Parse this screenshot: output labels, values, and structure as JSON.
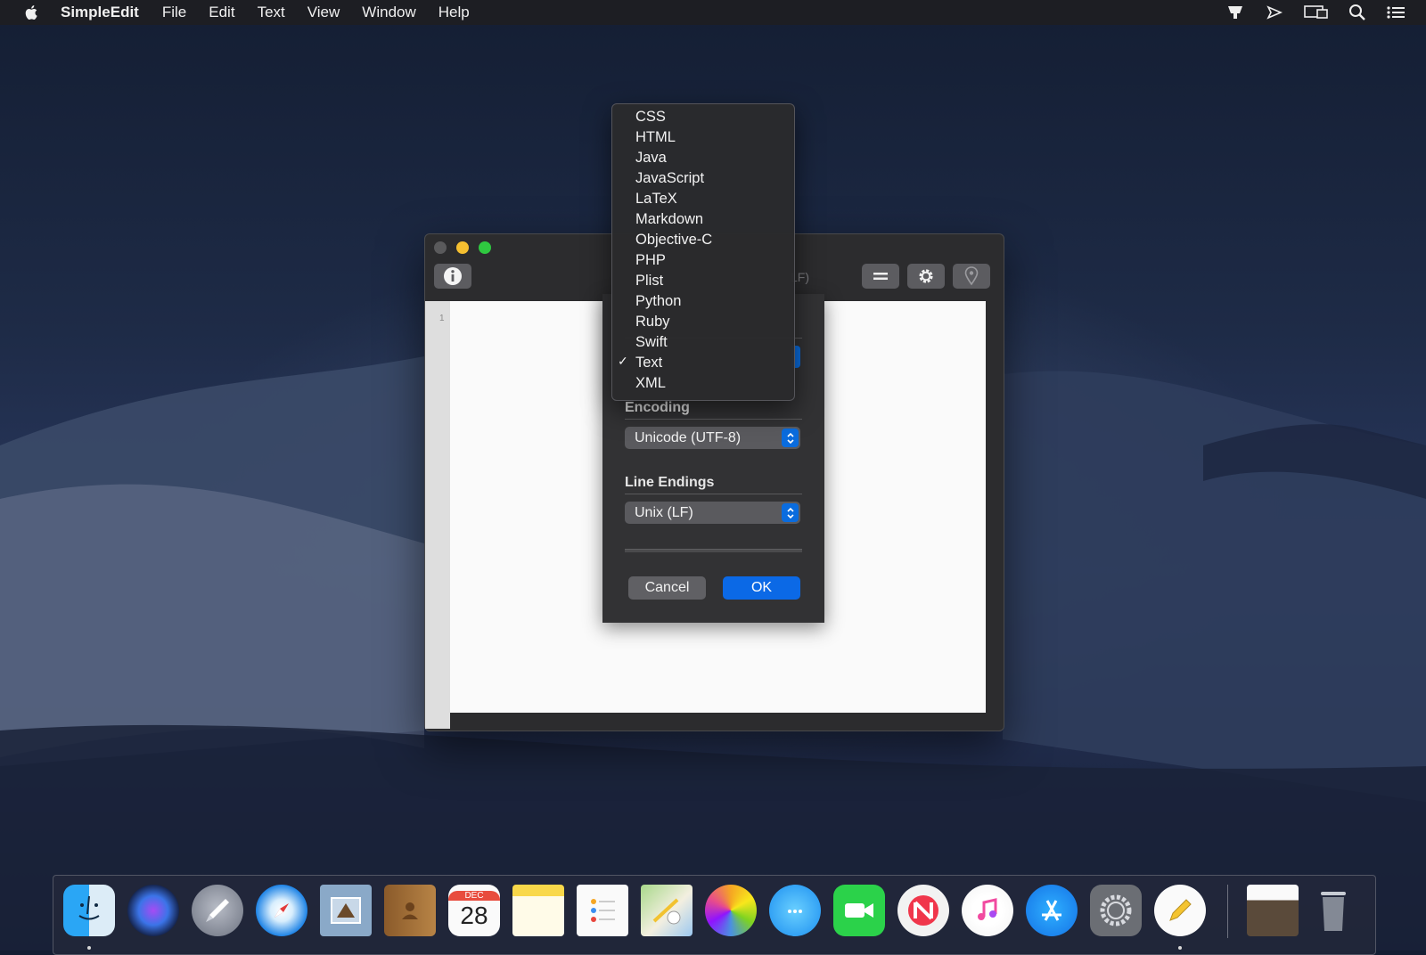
{
  "menubar": {
    "app_name": "SimpleEdit",
    "menus": [
      "File",
      "Edit",
      "Text",
      "View",
      "Window",
      "Help"
    ]
  },
  "window": {
    "title_fragment": "LF)",
    "line_number": "1"
  },
  "sheet": {
    "encoding_label": "Encoding",
    "encoding_value": "Unicode (UTF-8)",
    "line_endings_label": "Line Endings",
    "line_endings_value": "Unix (LF)",
    "cancel_label": "Cancel",
    "ok_label": "OK"
  },
  "syntax_menu": {
    "items": [
      "CSS",
      "HTML",
      "Java",
      "JavaScript",
      "LaTeX",
      "Markdown",
      "Objective-C",
      "PHP",
      "Plist",
      "Python",
      "Ruby",
      "Swift",
      "Text",
      "XML"
    ],
    "selected": "Text"
  },
  "dock": {
    "calendar_month": "DEC",
    "calendar_day": "28",
    "apps": [
      "finder-icon",
      "siri-icon",
      "launchpad-icon",
      "safari-icon",
      "mail-icon",
      "contacts-icon",
      "calendar-icon",
      "notes-icon",
      "reminders-icon",
      "maps-icon",
      "photos-icon",
      "messages-icon",
      "facetime-icon",
      "news-icon",
      "itunes-icon",
      "app-store-icon",
      "system-preferences-icon",
      "simpleedit-icon",
      "downloads-stack-icon",
      "trash-icon"
    ]
  },
  "colors": {
    "accent": "#0b69e6",
    "menu_bg": "#2a2a2c"
  }
}
